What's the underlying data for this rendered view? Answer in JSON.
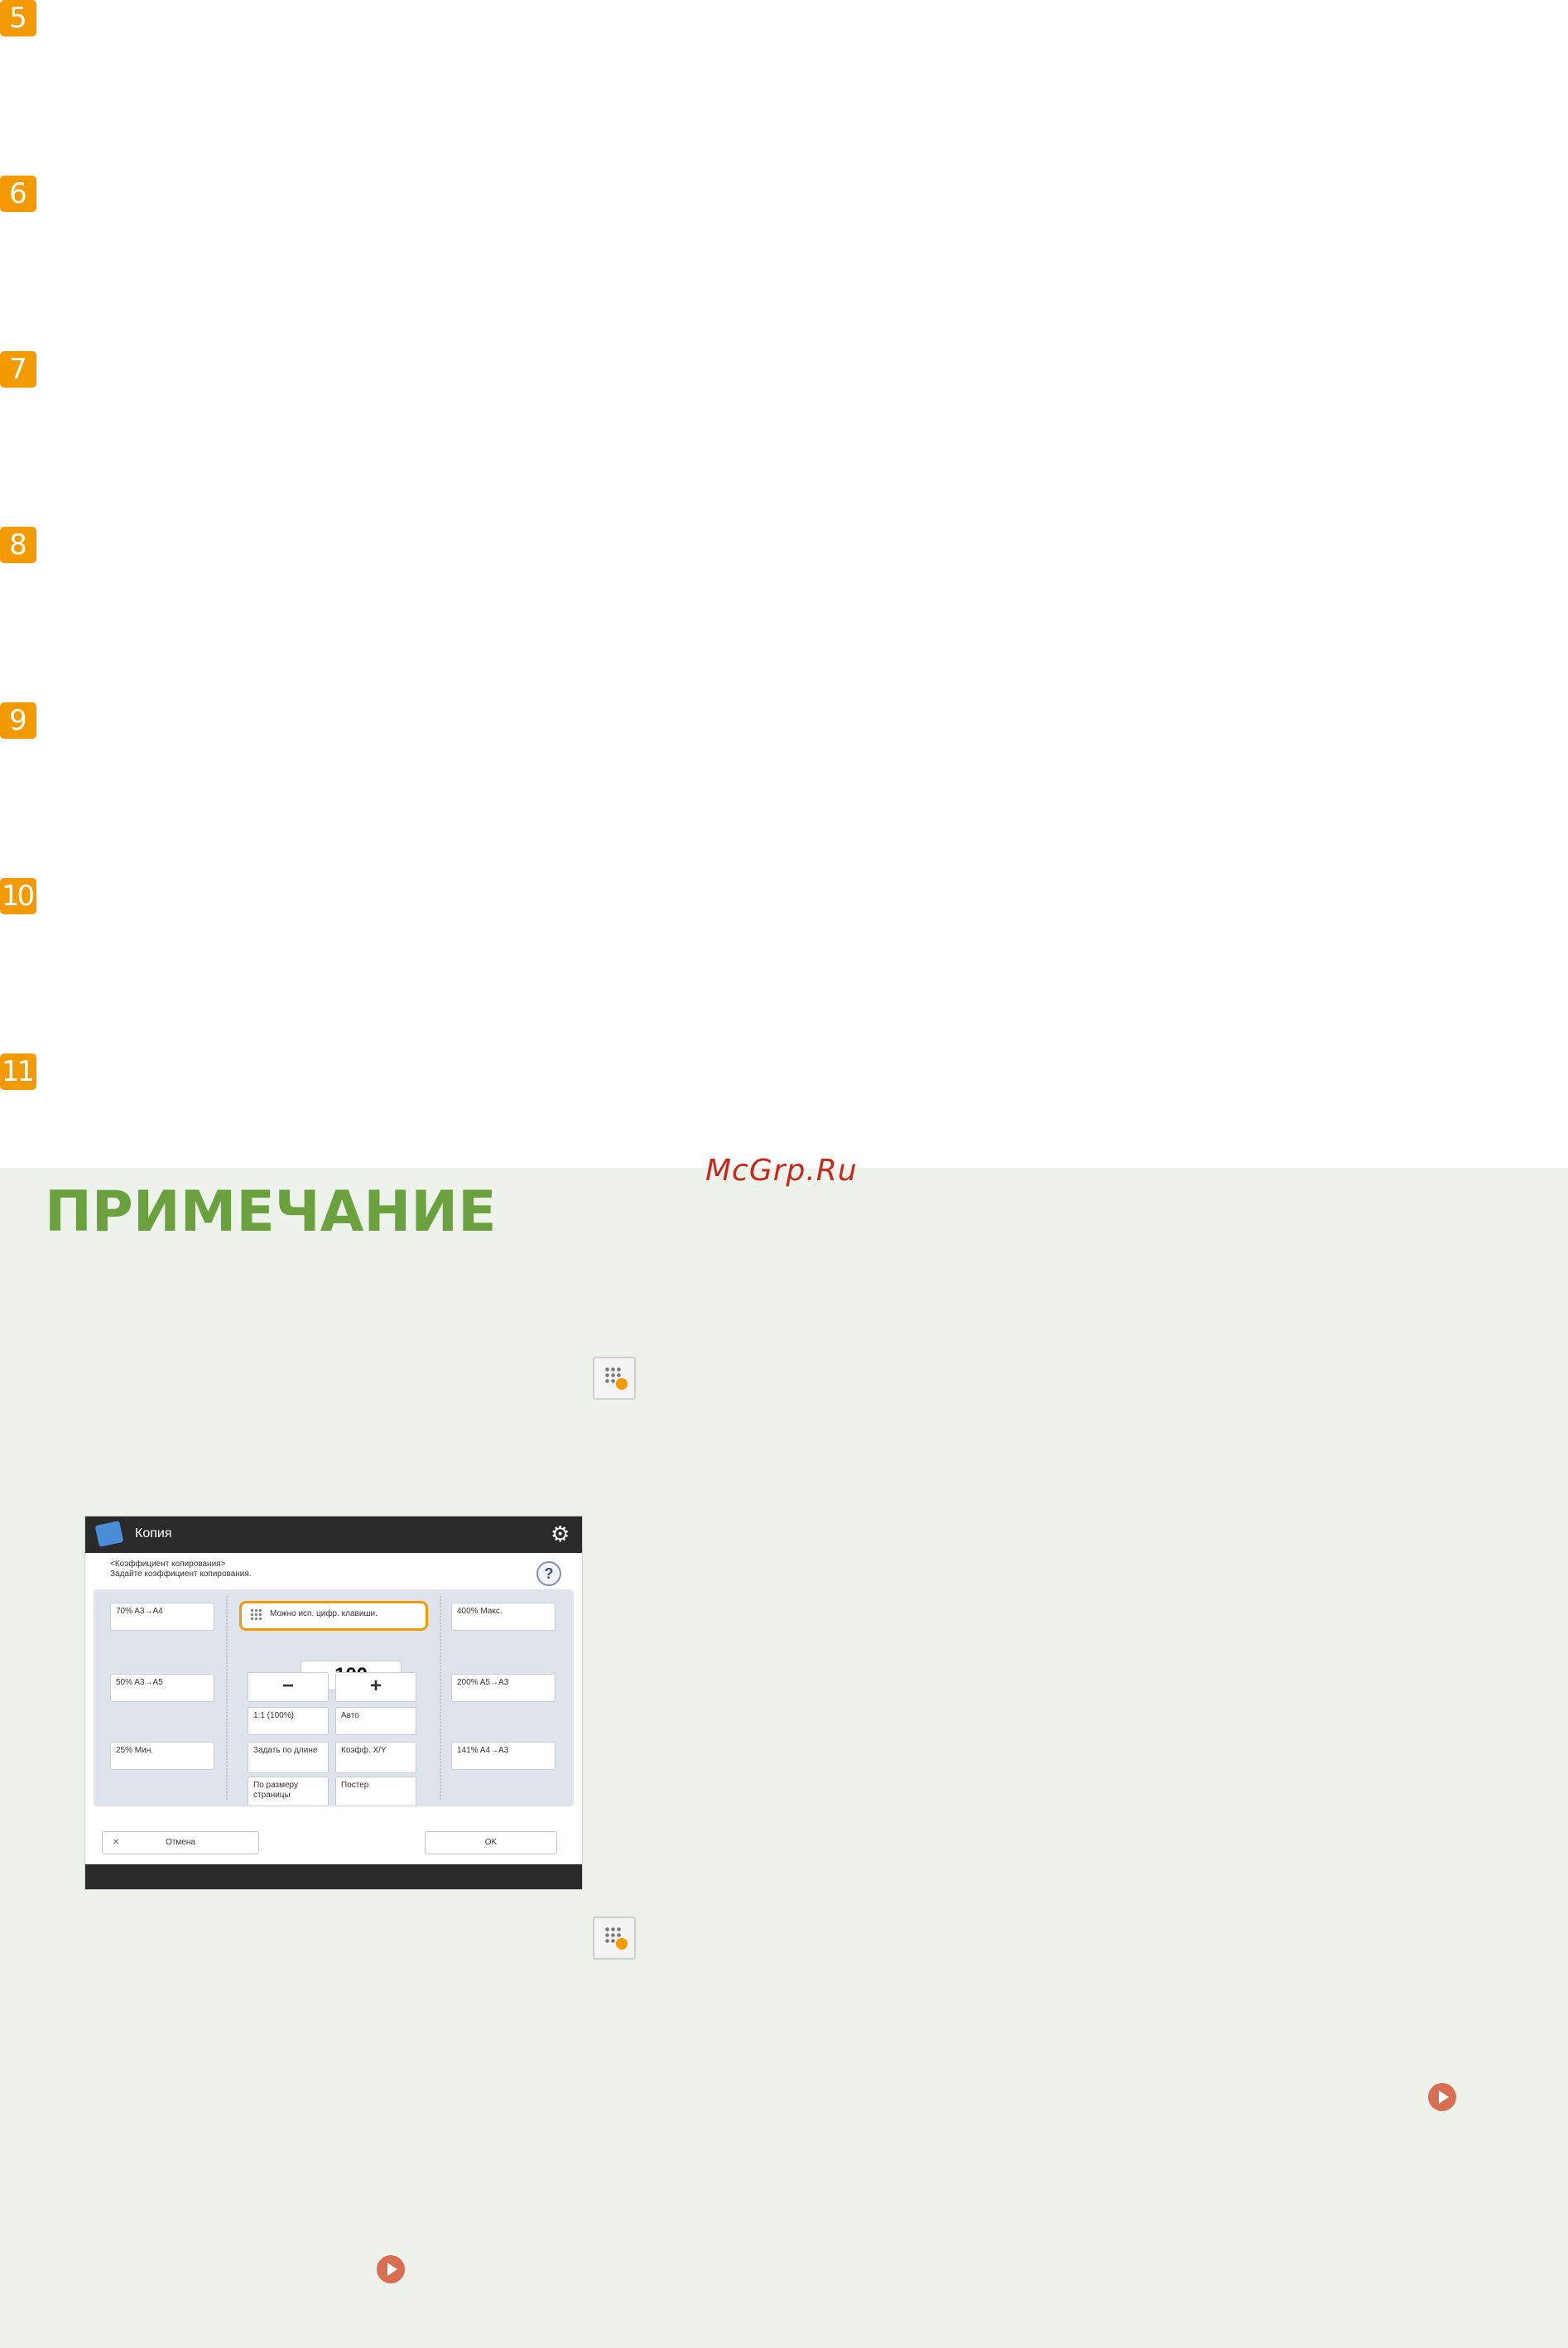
{
  "steps": [
    "5",
    "6",
    "7",
    "8",
    "9",
    "10",
    "11"
  ],
  "note": {
    "title": "ПРИМЕЧАНИЕ",
    "watermark": "McGrp.Ru"
  },
  "icons": {
    "numeric_keys": "numeric-keys-icon",
    "link": "play-circle-icon"
  },
  "device_screen": {
    "app_title": "Копия",
    "header_lines": [
      "<Коэффициент копирования>",
      "Задайте коэффициент копирования."
    ],
    "help_label": "?",
    "left_presets": [
      "70% A3→A4",
      "50% A3→A5",
      "25% Мин."
    ],
    "right_presets": [
      "400% Макс.",
      "200% A5→A3",
      "141% A4→A3"
    ],
    "numeric_entry_label": "Можно исп. цифр. клавиши.",
    "value": "100",
    "unit": "%",
    "minus": "−",
    "plus": "+",
    "center_buttons": [
      "1:1 (100%)",
      "Авто",
      "Задать по длине",
      "Коэфф. X/Y",
      "По размеру страницы",
      "Постер"
    ],
    "cancel_label": "Отмена",
    "ok_label": "OK"
  },
  "colors": {
    "step_badge": "#f39a00",
    "note_bg": "#edf3ea",
    "note_title": "#6aa13e",
    "watermark": "#c4291c",
    "link_icon": "#d86e52"
  }
}
